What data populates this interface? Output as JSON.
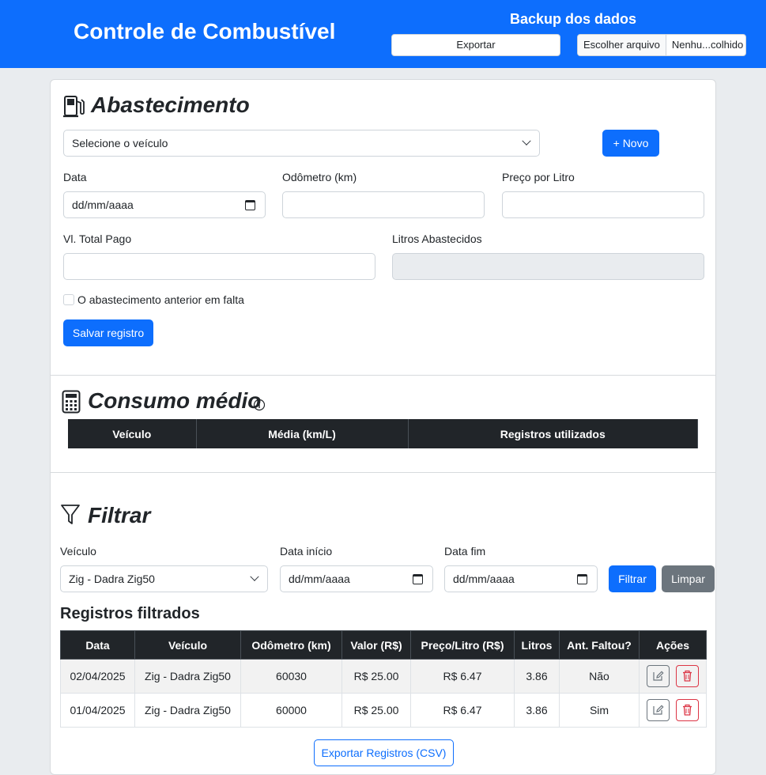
{
  "header": {
    "title": "Controle de Combustível",
    "backup_title": "Backup dos dados",
    "export_label": "Exportar",
    "file_button_label": "Escolher arquivo",
    "file_name": "Nenhu...colhido"
  },
  "abastecimento": {
    "title": "Abastecimento",
    "vehicle_select": "Selecione o veículo",
    "new_button": "+ Novo",
    "data_label": "Data",
    "data_placeholder": "dd/mm/aaaa",
    "odometro_label": "Odômetro (km)",
    "odometro_value": "",
    "preco_label": "Preço por Litro",
    "preco_value": "",
    "total_label": "Vl. Total Pago",
    "total_value": "",
    "litros_label": "Litros Abastecidos",
    "litros_value": "",
    "checkbox_label": "O abastecimento anterior em falta",
    "checkbox_checked": false,
    "save_button": "Salvar registro"
  },
  "consumo": {
    "title": "Consumo médio",
    "columns": [
      "Veículo",
      "Média (km/L)",
      "Registros utilizados"
    ]
  },
  "filtrar": {
    "title": "Filtrar",
    "veiculo_label": "Veículo",
    "veiculo_value": "Zig - Dadra Zig50",
    "inicio_label": "Data início",
    "inicio_placeholder": "dd/mm/aaaa",
    "fim_label": "Data fim",
    "fim_placeholder": "dd/mm/aaaa",
    "filtrar_button": "Filtrar",
    "limpar_button": "Limpar"
  },
  "registros": {
    "title": "Registros filtrados",
    "columns": [
      "Data",
      "Veículo",
      "Odômetro (km)",
      "Valor (R$)",
      "Preço/Litro (R$)",
      "Litros",
      "Ant. Faltou?",
      "Ações"
    ],
    "rows": [
      {
        "data": "02/04/2025",
        "veiculo": "Zig - Dadra Zig50",
        "odometro": "60030",
        "valor": "R$ 25.00",
        "preco": "R$ 6.47",
        "litros": "3.86",
        "faltou": "Não"
      },
      {
        "data": "01/04/2025",
        "veiculo": "Zig - Dadra Zig50",
        "odometro": "60000",
        "valor": "R$ 25.00",
        "preco": "R$ 6.47",
        "litros": "3.86",
        "faltou": "Sim"
      }
    ],
    "export_csv": "Exportar Registros (CSV)"
  },
  "icons": {
    "fuel": "fuel-pump-icon",
    "calculator": "calculator-icon",
    "info": "info-icon",
    "filter": "funnel-icon",
    "edit": "pencil-square-icon",
    "delete": "trash-icon"
  },
  "colors": {
    "primary": "#0d6efd",
    "dark": "#212529",
    "secondary": "#6c757d",
    "danger": "#dc3545"
  }
}
